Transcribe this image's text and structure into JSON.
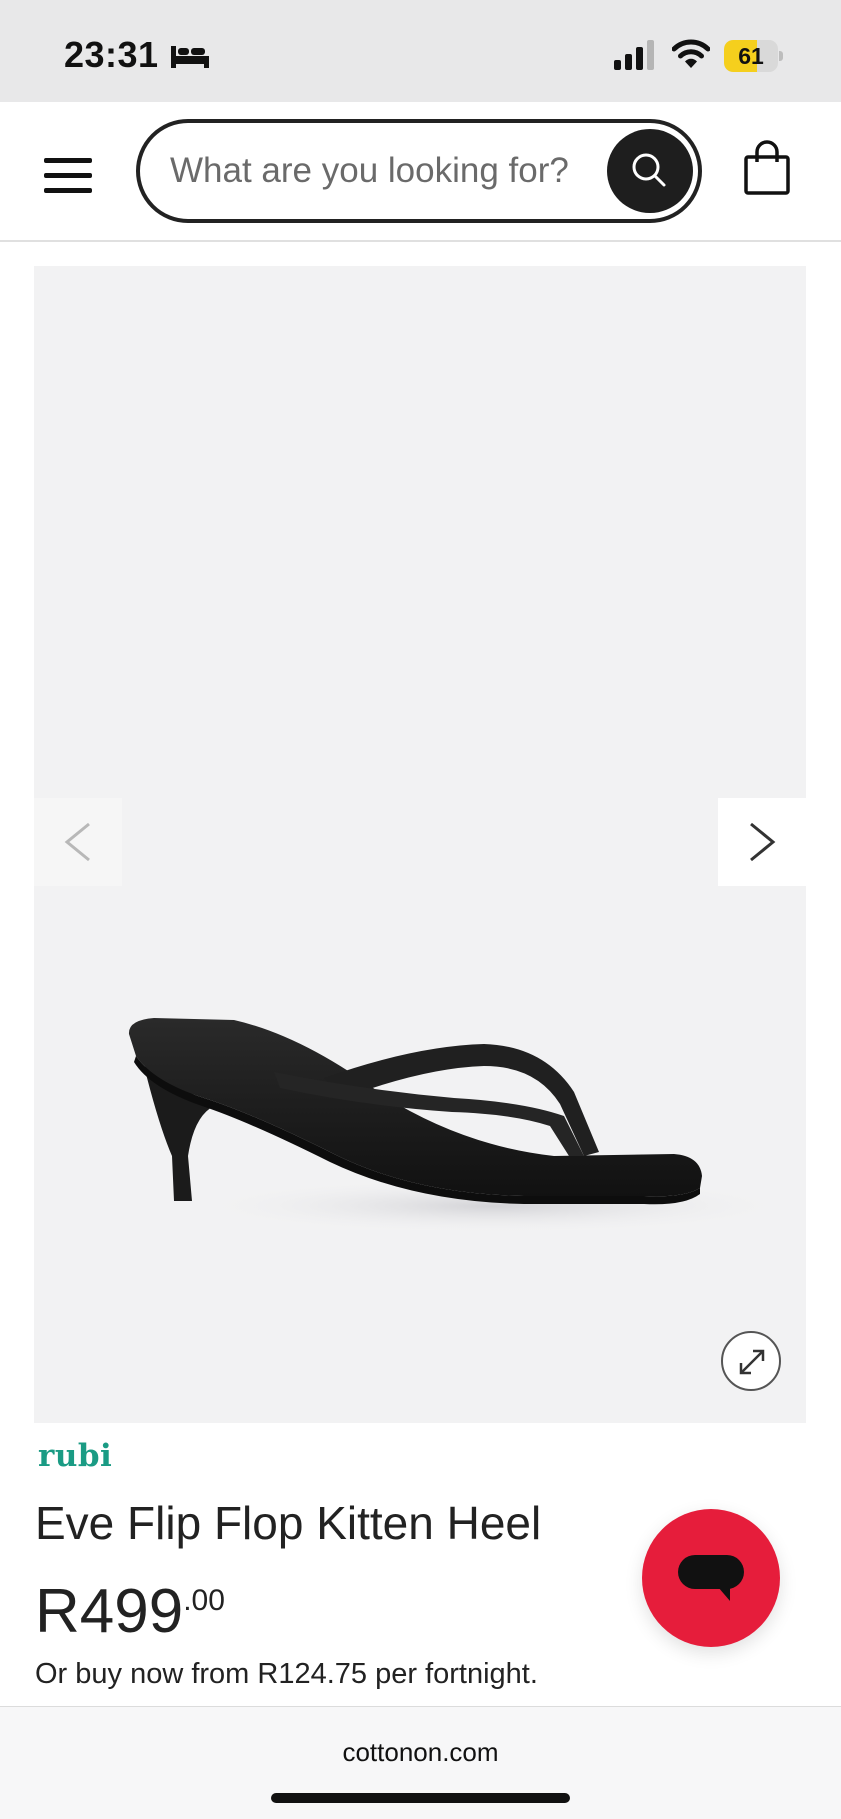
{
  "status_bar": {
    "time": "23:31",
    "battery_percent": "61",
    "battery_level": 0.61,
    "icons": [
      "bed-icon",
      "signal-icon",
      "wifi-icon",
      "battery-icon"
    ]
  },
  "header": {
    "menu_icon": "hamburger-menu-icon",
    "search_placeholder": "What are you looking for?",
    "search_icon": "search-icon",
    "bag_icon": "shopping-bag-icon"
  },
  "gallery": {
    "prev_icon": "chevron-left-icon",
    "next_icon": "chevron-right-icon",
    "expand_icon": "expand-icon",
    "background_color": "#f2f2f3"
  },
  "product": {
    "brand": "rubi",
    "title": "Eve Flip Flop Kitten Heel",
    "price_main": "R499",
    "price_cents": ".00",
    "installment_text": "Or buy now from R124.75 per fortnight."
  },
  "chat": {
    "icon": "chat-bubble-icon",
    "color": "#e61d3b"
  },
  "browser": {
    "url": "cottonon.com"
  },
  "colors": {
    "brand_accent": "#1a9b84",
    "chat_red": "#e61d3b",
    "battery_yellow": "#f5cf1d"
  }
}
